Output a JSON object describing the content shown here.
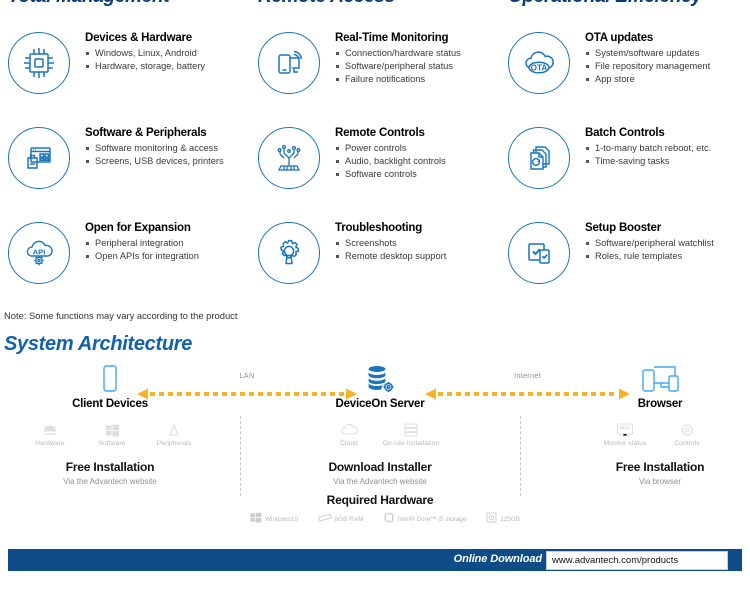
{
  "columns": [
    {
      "heading": "Total Management"
    },
    {
      "heading": "Remote Access"
    },
    {
      "heading": "Operational Efficiency"
    }
  ],
  "features": [
    {
      "icon": "chip-icon",
      "title": "Devices & Hardware",
      "items": [
        "Windows, Linux, Android",
        "Hardware, storage, battery"
      ]
    },
    {
      "icon": "realtime-monitoring-icon",
      "title": "Real-Time Monitoring",
      "items": [
        "Connection/hardware status",
        "Software/peripheral status",
        "Failure notifications"
      ]
    },
    {
      "icon": "ota-cloud-icon",
      "title": "OTA updates",
      "items": [
        "System/software updates",
        "File repository management",
        "App store"
      ]
    },
    {
      "icon": "software-peripherals-icon",
      "title": "Software & Peripherals",
      "items": [
        "Software monitoring & access",
        "Screens, USB devices, printers"
      ]
    },
    {
      "icon": "remote-controls-icon",
      "title": "Remote Controls",
      "items": [
        "Power controls",
        "Audio, backlight controls",
        "Software controls"
      ]
    },
    {
      "icon": "batch-controls-icon",
      "title": "Batch Controls",
      "items": [
        "1-to-many batch reboot, etc.",
        "Time-saving tasks"
      ]
    },
    {
      "icon": "api-cloud-gear-icon",
      "title": "Open for Expansion",
      "items": [
        "Peripheral integration",
        "Open APIs for integration"
      ]
    },
    {
      "icon": "troubleshooting-gear-wrench-icon",
      "title": "Troubleshooting",
      "items": [
        "Screenshots",
        "Remote desktop support"
      ]
    },
    {
      "icon": "setup-booster-icon",
      "title": "Setup Booster",
      "items": [
        "Software/peripheral watchlist",
        "Roles, rule templates"
      ]
    }
  ],
  "note": "Note: Some functions may vary according to the product",
  "architecture": {
    "title": "System Architecture",
    "nodes": [
      {
        "id": "client-devices",
        "icon": "tablet-icon",
        "name": "Client Devices",
        "sub_items": [
          {
            "icon": "android-hardware-icon",
            "label": "Hardware"
          },
          {
            "icon": "windows-software-icon",
            "label": "Software"
          },
          {
            "icon": "peripherals-icon",
            "label": "Peripherals"
          }
        ],
        "install_title": "Free Installation",
        "install_sub": "Via the Advantech website"
      },
      {
        "id": "deviceon-server",
        "icon": "database-gear-icon",
        "name": "DeviceOn Server",
        "sub_items": [
          {
            "icon": "cloud-icon",
            "label": "Cloud"
          },
          {
            "icon": "onsite-server-icon",
            "label": "On-site installation"
          }
        ],
        "install_title": "Download Installer",
        "install_sub": "Via the Advantech website"
      },
      {
        "id": "browser",
        "icon": "multi-device-browser-icon",
        "name": "Browser",
        "sub_items": [
          {
            "icon": "monitor-status-icon",
            "label": "Monitor status"
          },
          {
            "icon": "controls-gear-icon",
            "label": "Controls"
          }
        ],
        "install_title": "Free Installation",
        "install_sub": "Via browser"
      }
    ],
    "connections": [
      {
        "id": "lan-link",
        "label": "LAN"
      },
      {
        "id": "internet-link",
        "label": "Internet"
      }
    ],
    "requirements_title": "Required Hardware",
    "requirements": [
      {
        "icon": "windows-icon",
        "label": "Windows10"
      },
      {
        "icon": "ram-icon",
        "label": "8GB RAM"
      },
      {
        "icon": "cpu-icon",
        "label": "Intel® Core™ i5 storage"
      },
      {
        "icon": "storage-icon",
        "label": "125GB"
      }
    ]
  },
  "footer": {
    "download_label": "Online Download",
    "url": "www.advantech.com/products"
  },
  "colors": {
    "heading_blue": "#0b3d74",
    "accent_blue": "#1b75bb",
    "section_blue": "#1261ad",
    "footer_blue": "#0d4c86",
    "arrow_orange": "#f5b325",
    "muted_gray": "#b4b8bb"
  }
}
